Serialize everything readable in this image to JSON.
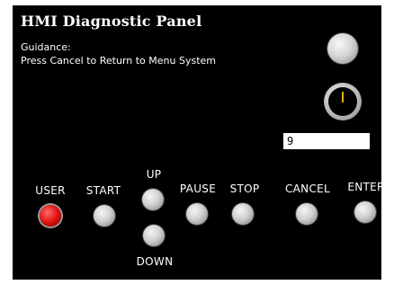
{
  "panel": {
    "title": "HMI Diagnostic Panel",
    "guidance_label": "Guidance:",
    "guidance_text": "Press Cancel to Return to Menu System"
  },
  "value_field": {
    "value": "9"
  },
  "buttons": {
    "user": "USER",
    "start": "START",
    "up": "UP",
    "pause": "PAUSE",
    "stop": "STOP",
    "cancel": "CANCEL",
    "enter": "ENTER",
    "down": "DOWN"
  },
  "colors": {
    "panel_bg": "#000000",
    "text": "#ffffff",
    "user_button": "#e41a1a",
    "button_gray": "#cfcfcf",
    "knob_indicator": "#e0b000"
  },
  "icons": {
    "top_button": "round-gray-button-icon",
    "knob": "rotary-knob-icon"
  }
}
